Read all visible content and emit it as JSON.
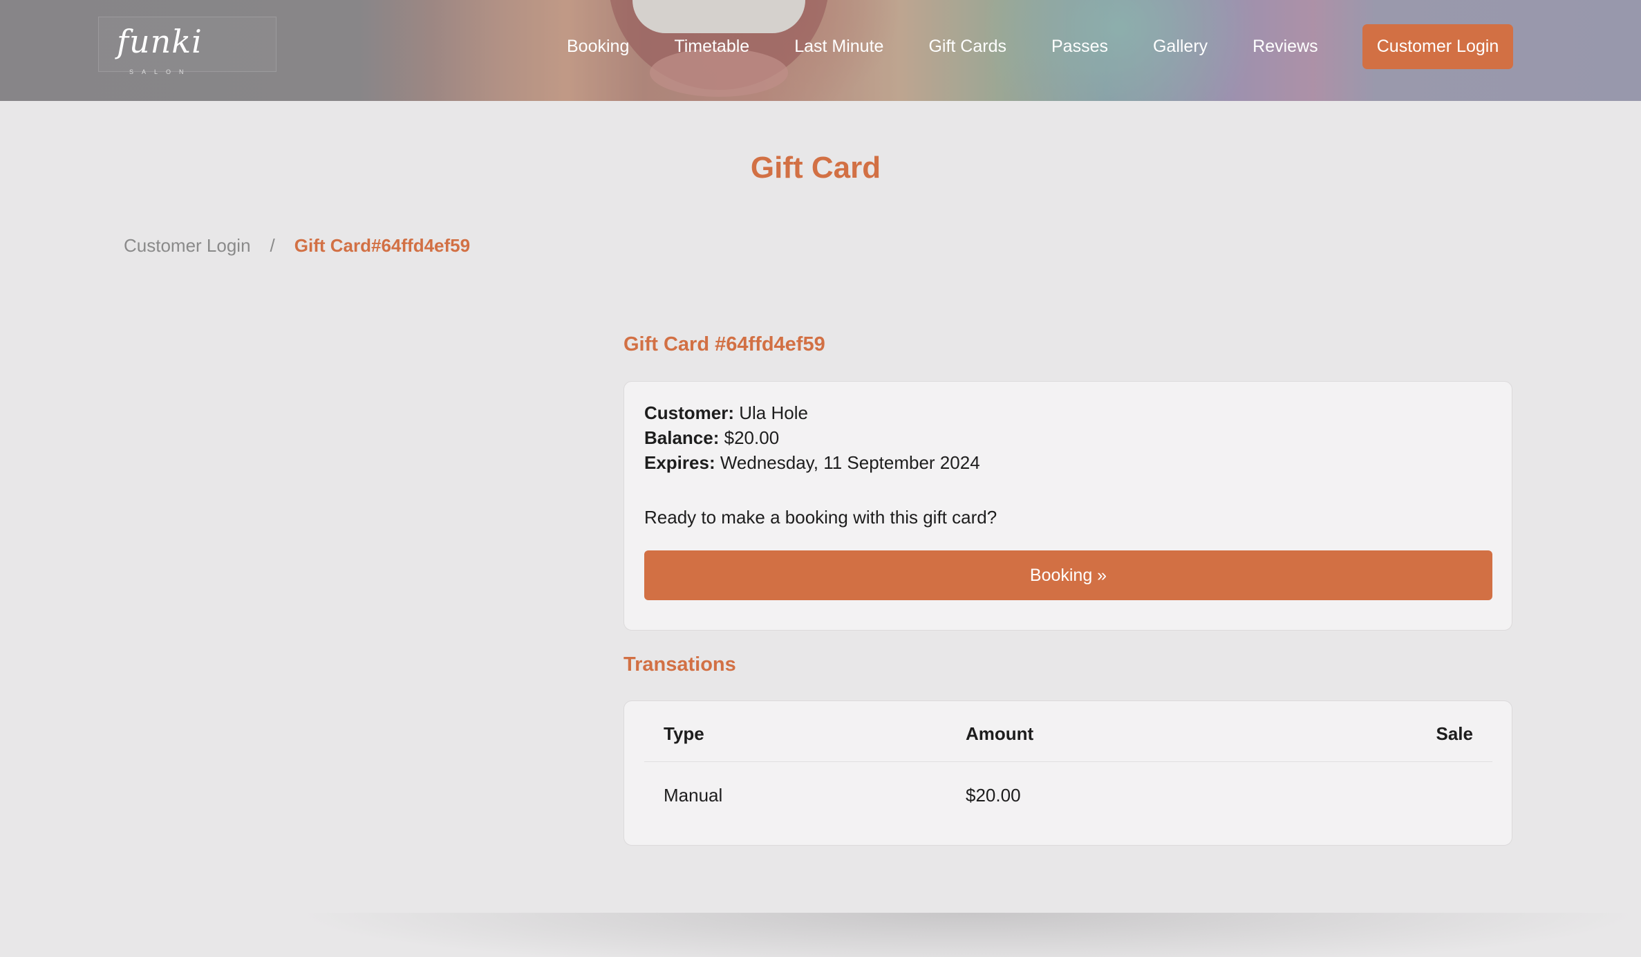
{
  "brand": {
    "logo_text": "funki",
    "logo_sub": "SALON"
  },
  "nav": {
    "items": [
      {
        "label": "Booking"
      },
      {
        "label": "Timetable"
      },
      {
        "label": "Last Minute"
      },
      {
        "label": "Gift Cards"
      },
      {
        "label": "Passes"
      },
      {
        "label": "Gallery"
      },
      {
        "label": "Reviews"
      }
    ],
    "login_button": "Customer Login"
  },
  "page": {
    "title": "Gift Card"
  },
  "breadcrumb": {
    "parent": "Customer Login",
    "separator": "/",
    "current": "Gift Card#64ffd4ef59"
  },
  "gift_card": {
    "heading": "Gift Card #64ffd4ef59",
    "customer_label": "Customer:",
    "customer_value": "Ula Hole",
    "balance_label": "Balance:",
    "balance_value": "$20.00",
    "expires_label": "Expires:",
    "expires_value": "Wednesday, 11 September 2024",
    "prompt": "Ready to make a booking with this gift card?",
    "booking_button": "Booking »"
  },
  "transactions": {
    "heading": "Transations",
    "columns": {
      "type": "Type",
      "amount": "Amount",
      "sale": "Sale"
    },
    "rows": [
      {
        "type": "Manual",
        "amount": "$20.00",
        "sale": ""
      }
    ]
  },
  "colors": {
    "accent": "#d27044",
    "background": "#e8e7e8",
    "card": "#f3f2f3"
  }
}
